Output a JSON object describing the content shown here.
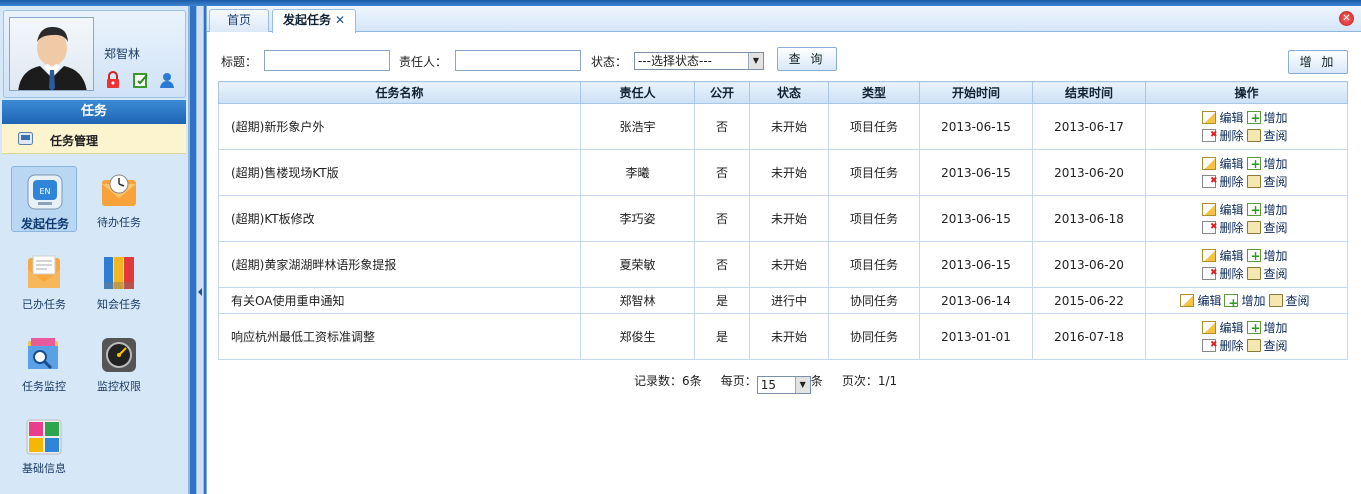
{
  "user": {
    "name": "郑智林"
  },
  "sidebar": {
    "section_title": "任务",
    "menu_label": "任务管理",
    "tiles": [
      {
        "label": "发起任务"
      },
      {
        "label": "待办任务"
      },
      {
        "label": "已办任务"
      },
      {
        "label": "知会任务"
      },
      {
        "label": "任务监控"
      },
      {
        "label": "监控权限"
      },
      {
        "label": "基础信息"
      }
    ]
  },
  "tabs": [
    {
      "label": "首页"
    },
    {
      "label": "发起任务"
    }
  ],
  "search": {
    "title_label": "标题：",
    "owner_label": "责任人：",
    "status_label": "状态：",
    "status_selected": "---选择状态---",
    "query_button": "查 询",
    "add_button": "增 加"
  },
  "table": {
    "headers": [
      "任务名称",
      "责任人",
      "公开",
      "状态",
      "类型",
      "开始时间",
      "结束时间",
      "操作"
    ],
    "action_labels": {
      "edit": "编辑",
      "add": "增加",
      "delete": "删除",
      "view": "查阅"
    },
    "rows": [
      {
        "name": "(超期)新形象户外",
        "owner": "张浩宇",
        "public": "否",
        "status": "未开始",
        "type": "项目任务",
        "start": "2013-06-15",
        "end": "2013-06-17"
      },
      {
        "name": "(超期)售楼现场KT版",
        "owner": "李曦",
        "public": "否",
        "status": "未开始",
        "type": "项目任务",
        "start": "2013-06-15",
        "end": "2013-06-20"
      },
      {
        "name": "(超期)KT板修改",
        "owner": "李巧姿",
        "public": "否",
        "status": "未开始",
        "type": "项目任务",
        "start": "2013-06-15",
        "end": "2013-06-18"
      },
      {
        "name": "(超期)黄家湖湖畔林语形象提报",
        "owner": "夏荣敏",
        "public": "否",
        "status": "未开始",
        "type": "项目任务",
        "start": "2013-06-15",
        "end": "2013-06-20"
      },
      {
        "name": "有关OA使用重申通知",
        "owner": "郑智林",
        "public": "是",
        "status": "进行中",
        "type": "协同任务",
        "start": "2013-06-14",
        "end": "2015-06-22"
      },
      {
        "name": "响应杭州最低工资标准调整",
        "owner": "郑俊生",
        "public": "是",
        "status": "未开始",
        "type": "协同任务",
        "start": "2013-01-01",
        "end": "2016-07-18"
      }
    ]
  },
  "pager": {
    "records_label": "记录数：6条",
    "per_page_label": "每页：",
    "per_page_value": "15",
    "per_page_suffix": "条",
    "page_label": "页次：1/1"
  },
  "colors": {
    "frame_blue": "#2f74c4",
    "header_blue": "#1f65b5",
    "menu_yellow": "#fbf4cf",
    "close_red": "#c01818"
  }
}
